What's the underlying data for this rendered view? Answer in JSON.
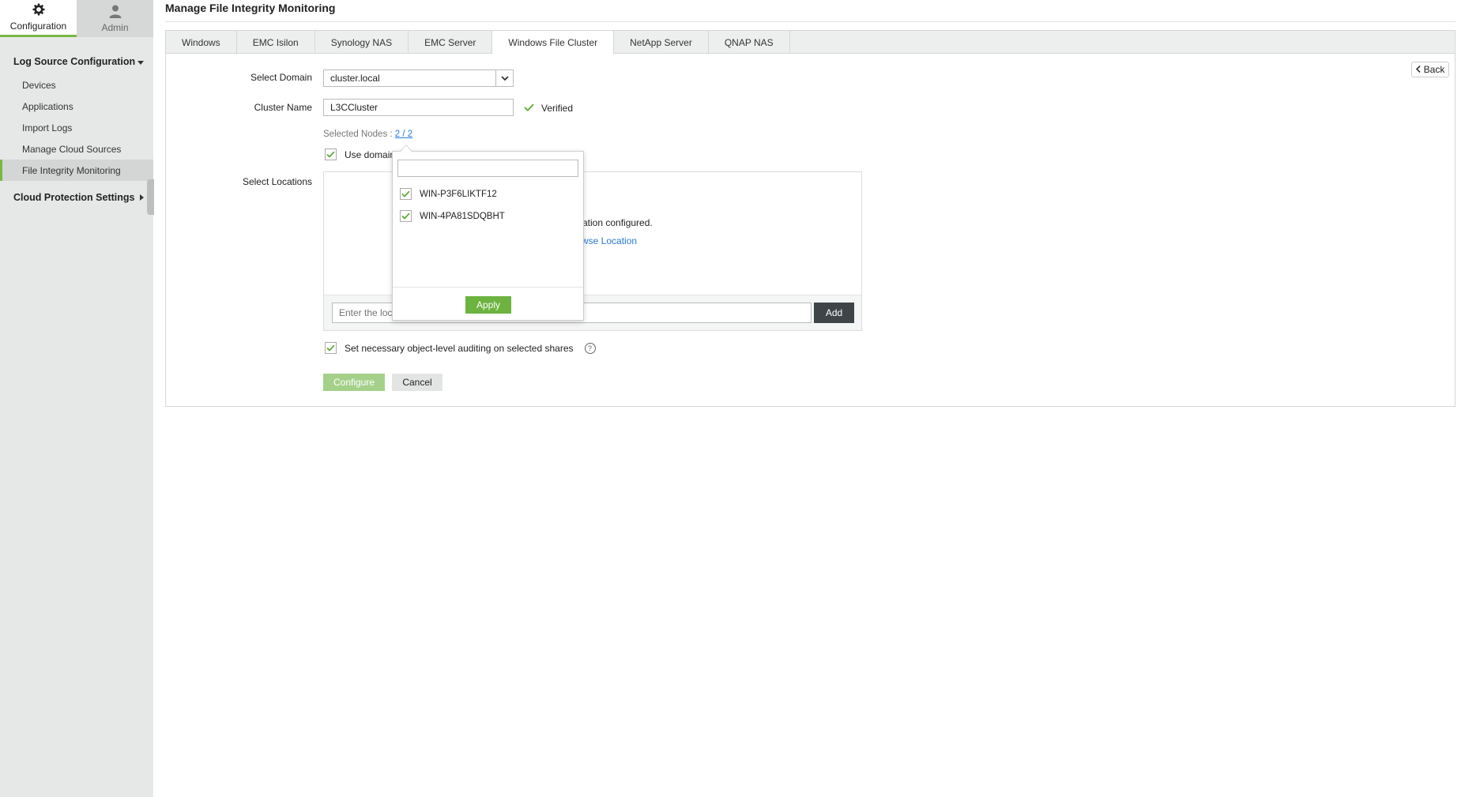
{
  "nav": {
    "configuration_label": "Configuration",
    "admin_label": "Admin"
  },
  "sidebar": {
    "section1": "Log Source Configuration",
    "items": [
      "Devices",
      "Applications",
      "Import Logs",
      "Manage Cloud Sources",
      "File Integrity Monitoring"
    ],
    "section2": "Cloud Protection Settings"
  },
  "page": {
    "title": "Manage File Integrity Monitoring"
  },
  "tabs": [
    "Windows",
    "EMC Isilon",
    "Synology NAS",
    "EMC Server",
    "Windows File Cluster",
    "NetApp Server",
    "QNAP NAS"
  ],
  "active_tab": "Windows File Cluster",
  "back_label": "Back",
  "form": {
    "domain_label": "Select Domain",
    "domain_value": "cluster.local",
    "cluster_label": "Cluster Name",
    "cluster_value": "L3CCluster",
    "verified_label": "Verified",
    "selected_nodes_label": "Selected Nodes :",
    "selected_nodes_value": "2 / 2",
    "use_domain_label": "Use domain",
    "locations_label": "Select Locations",
    "empty_fragment": "ation configured.",
    "browse_fragment": "wse Location",
    "location_placeholder": "Enter the loca",
    "add_label": "Add",
    "audit_label": "Set necessary object-level auditing on selected shares",
    "configure_label": "Configure",
    "cancel_label": "Cancel"
  },
  "popup": {
    "nodes": [
      "WIN-P3F6LIKTF12",
      "WIN-4PA81SDQBHT"
    ],
    "apply_label": "Apply"
  },
  "colors": {
    "accent": "#79b743",
    "link": "#2a7ad6",
    "dark_button": "#3e4548"
  }
}
